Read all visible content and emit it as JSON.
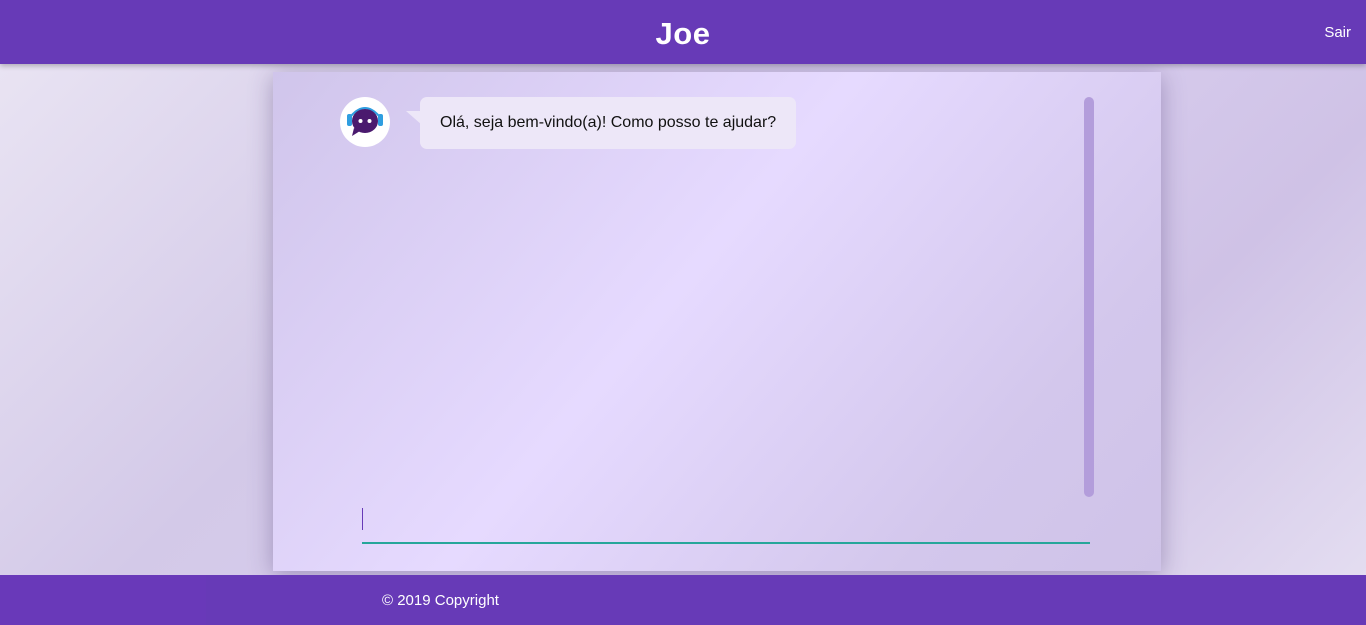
{
  "header": {
    "title": "Joe",
    "logout_label": "Sair"
  },
  "chat": {
    "messages": [
      {
        "sender": "bot",
        "avatar_icon": "chat-bubble-robot-icon",
        "text": "Olá, seja bem-vindo(a)! Como posso te ajudar?"
      }
    ],
    "input": {
      "value": "",
      "placeholder": ""
    }
  },
  "footer": {
    "copyright": "© 2019 Copyright"
  },
  "colors": {
    "primary": "#673ab7",
    "accent_underline": "#26a69a",
    "scrollbar": "#b39ddb",
    "bubble": "#ede7f8"
  }
}
